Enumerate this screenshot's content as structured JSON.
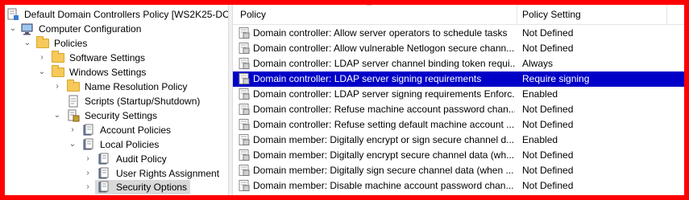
{
  "tree": {
    "root_label": "Default Domain Controllers Policy [WS2K25-DC",
    "computer_config": "Computer Configuration",
    "policies": "Policies",
    "software_settings": "Software Settings",
    "windows_settings": "Windows Settings",
    "name_resolution": "Name Resolution Policy",
    "scripts": "Scripts (Startup/Shutdown)",
    "security_settings": "Security Settings",
    "account_policies": "Account Policies",
    "local_policies": "Local Policies",
    "audit_policy": "Audit Policy",
    "user_rights": "User Rights Assignment",
    "security_options": "Security Options"
  },
  "list": {
    "header_policy": "Policy",
    "header_setting": "Policy Setting",
    "rows": [
      {
        "name": "Domain controller: Allow server operators to schedule tasks",
        "setting": "Not Defined"
      },
      {
        "name": "Domain controller: Allow vulnerable Netlogon secure chann...",
        "setting": "Not Defined"
      },
      {
        "name": "Domain controller: LDAP server channel binding token requi...",
        "setting": "Always"
      },
      {
        "name": "Domain controller: LDAP server signing requirements",
        "setting": "Require signing"
      },
      {
        "name": "Domain controller: LDAP server signing requirements Enforc...",
        "setting": "Enabled"
      },
      {
        "name": "Domain controller: Refuse machine account password chan...",
        "setting": "Not Defined"
      },
      {
        "name": "Domain controller: Refuse setting default machine account ...",
        "setting": "Not Defined"
      },
      {
        "name": "Domain member: Digitally encrypt or sign secure channel d...",
        "setting": "Enabled"
      },
      {
        "name": "Domain member: Digitally encrypt secure channel data (wh...",
        "setting": "Not Defined"
      },
      {
        "name": "Domain member: Digitally sign secure channel data (when ...",
        "setting": "Not Defined"
      },
      {
        "name": "Domain member: Disable machine account password chan...",
        "setting": "Not Defined"
      }
    ]
  },
  "colors": {
    "frame": "#ff0000",
    "selection": "#0000c8",
    "tree_selected": "#d9d9d9"
  }
}
